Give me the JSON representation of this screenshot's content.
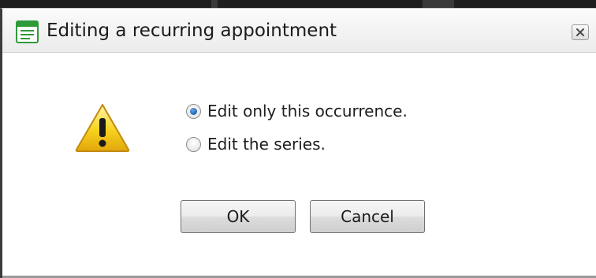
{
  "dialog": {
    "title": "Editing a recurring appointment",
    "title_icon": "calendar-window-icon",
    "close_icon": "close-x-icon"
  },
  "content": {
    "warning_icon": "warning-exclamation-icon",
    "options": [
      {
        "label": "Edit only this occurrence.",
        "checked": true
      },
      {
        "label": "Edit the series.",
        "checked": false
      }
    ]
  },
  "buttons": {
    "ok_label": "OK",
    "cancel_label": "Cancel"
  },
  "colors": {
    "accent": "#1f5fae",
    "icon_green": "#2e9a3a",
    "warning_yellow": "#f6d21c"
  }
}
